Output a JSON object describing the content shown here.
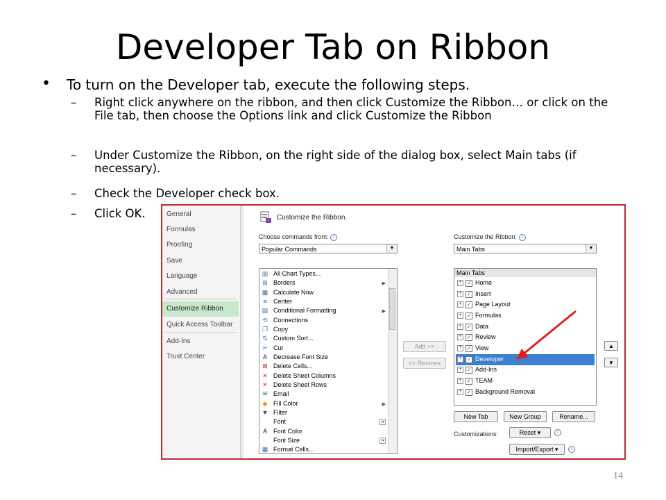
{
  "title": "Developer Tab on Ribbon",
  "bullet": {
    "marker": "•",
    "text": "To turn on the Developer tab, execute the following steps."
  },
  "steps": [
    {
      "dash": "–",
      "text": "Right click anywhere on the ribbon, and then click Customize the Ribbon… or click on the File tab, then choose the Options link and click Customize the Ribbon"
    },
    {
      "dash": "–",
      "text": "Under Customize the Ribbon, on the right side of the dialog box, select Main tabs (if necessary)."
    },
    {
      "dash": "–",
      "text": "Check the Developer check box."
    },
    {
      "dash": "–",
      "text": "Click OK."
    }
  ],
  "page_number": "14",
  "dialog": {
    "nav_items": [
      "General",
      "Formulas",
      "Proofing",
      "Save",
      "Language",
      "Advanced",
      "Customize Ribbon",
      "Quick Access Toolbar",
      "Add-Ins",
      "Trust Center"
    ],
    "header": "Customize the Ribbon.",
    "choose_label": "Choose commands from:",
    "choose_value": "Popular Commands",
    "customize_label": "Customize the Ribbon:",
    "customize_value": "Main Tabs",
    "commands": [
      "All Chart Types...",
      "Borders",
      "Calculate Now",
      "Center",
      "Conditional Formatting",
      "Connections",
      "Copy",
      "Custom Sort...",
      "Cut",
      "Decrease Font Size",
      "Delete Cells...",
      "Delete Sheet Columns",
      "Delete Sheet Rows",
      "Email",
      "Fill Color",
      "Filter",
      "Font",
      "Font Color",
      "Font Size",
      "Format Cells..."
    ],
    "add_button": "Add >>",
    "remove_button": "<< Remove",
    "main_tabs_header": "Main Tabs",
    "tabs": [
      "Home",
      "Insert",
      "Page Layout",
      "Formulas",
      "Data",
      "Review",
      "View",
      "Developer",
      "Add-Ins",
      "TEAM",
      "Background Removal"
    ],
    "new_tab": "New Tab",
    "new_group": "New Group",
    "rename": "Rename...",
    "customizations_label": "Customizations:",
    "reset": "Reset ▾",
    "import_export": "Import/Export ▾",
    "info_symbol": "i",
    "accent_color": "#3d7fd0",
    "selected_nav_color": "#c7e8cd",
    "arrow_color": "#e02020",
    "border_color": "#c0282d"
  }
}
